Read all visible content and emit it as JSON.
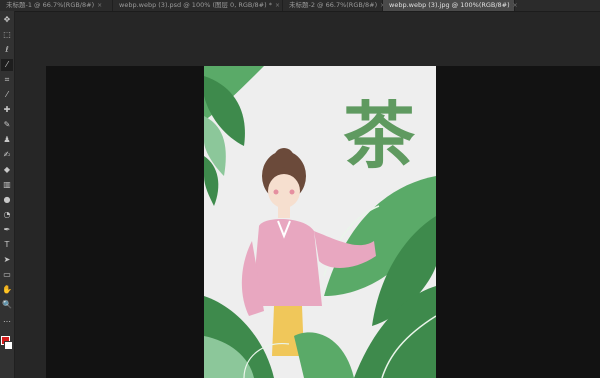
{
  "tabs": [
    {
      "label": "未标题-1 @ 66.7%(RGB/8#)",
      "active": false
    },
    {
      "label": "webp.webp (3).psd @ 100% (图层 0, RGB/8#) *",
      "active": false
    },
    {
      "label": "未标题-2 @ 66.7%(RGB/8#)",
      "active": false
    },
    {
      "label": "webp.webp (3).jpg @ 100%(RGB/8#)",
      "active": true
    }
  ],
  "close_glyph": "×",
  "tools": [
    {
      "name": "move-tool-icon",
      "glyph": "✥"
    },
    {
      "name": "marquee-tool-icon",
      "glyph": "⬚"
    },
    {
      "name": "lasso-tool-icon",
      "glyph": "ℓ"
    },
    {
      "name": "magic-wand-tool-icon",
      "glyph": "⁄",
      "active": true
    },
    {
      "name": "crop-tool-icon",
      "glyph": "⌗"
    },
    {
      "name": "eyedropper-tool-icon",
      "glyph": "⁄"
    },
    {
      "name": "healing-brush-tool-icon",
      "glyph": "✚"
    },
    {
      "name": "brush-tool-icon",
      "glyph": "✎"
    },
    {
      "name": "clone-stamp-tool-icon",
      "glyph": "♟"
    },
    {
      "name": "history-brush-tool-icon",
      "glyph": "✍"
    },
    {
      "name": "eraser-tool-icon",
      "glyph": "◆"
    },
    {
      "name": "gradient-tool-icon",
      "glyph": "▥"
    },
    {
      "name": "blur-tool-icon",
      "glyph": "●"
    },
    {
      "name": "dodge-tool-icon",
      "glyph": "◔"
    },
    {
      "name": "pen-tool-icon",
      "glyph": "✒"
    },
    {
      "name": "type-tool-icon",
      "glyph": "T"
    },
    {
      "name": "path-selection-tool-icon",
      "glyph": "➤"
    },
    {
      "name": "rectangle-tool-icon",
      "glyph": "▭"
    },
    {
      "name": "hand-tool-icon",
      "glyph": "✋"
    },
    {
      "name": "zoom-tool-icon",
      "glyph": "🔍"
    },
    {
      "name": "more-tools-icon",
      "glyph": "…"
    }
  ],
  "artwork": {
    "title_char": "茶",
    "title_color": "#5f9a60",
    "paper_color": "#eeeeee",
    "leaf_dark": "#3e8a4c",
    "leaf_mid": "#5aaa68",
    "leaf_light": "#8cc79a",
    "robe_color": "#e8a7c0",
    "skirt_color": "#f0c75a"
  },
  "swatches": {
    "foreground": "#d41c1c",
    "background": "#ffffff"
  }
}
